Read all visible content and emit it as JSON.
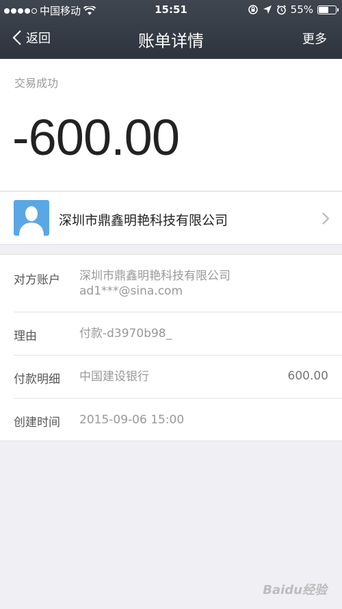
{
  "status_bar": {
    "carrier": "中国移动",
    "time": "15:51",
    "battery": "55%",
    "battery_level": 0.55
  },
  "nav": {
    "back_label": "返回",
    "title": "账单详情",
    "more_label": "更多"
  },
  "summary": {
    "status": "交易成功",
    "amount": "-600.00"
  },
  "counterparty": {
    "name": "深圳市鼎鑫明艳科技有限公司"
  },
  "details": {
    "account_label": "对方账户",
    "account_name": "深圳市鼎鑫明艳科技有限公司",
    "account_email": "ad1***@sina.com",
    "reason_label": "理由",
    "reason_value": "付款-d3970b98_",
    "payment_label": "付款明细",
    "payment_bank": "中国建设银行",
    "payment_amount": "600.00",
    "created_label": "创建时间",
    "created_value": "2015-09-06 15:00"
  },
  "watermark": "Baidu经验"
}
